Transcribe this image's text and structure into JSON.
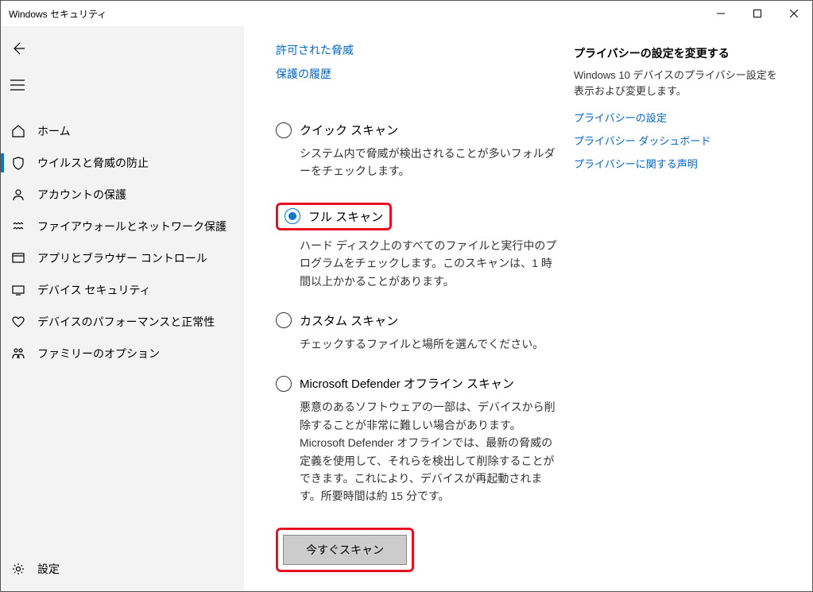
{
  "window": {
    "title": "Windows セキュリティ"
  },
  "sidebar": {
    "items": [
      {
        "label": "ホーム"
      },
      {
        "label": "ウイルスと脅威の防止"
      },
      {
        "label": "アカウントの保護"
      },
      {
        "label": "ファイアウォールとネットワーク保護"
      },
      {
        "label": "アプリとブラウザー コントロール"
      },
      {
        "label": "デバイス セキュリティ"
      },
      {
        "label": "デバイスのパフォーマンスと正常性"
      },
      {
        "label": "ファミリーのオプション"
      }
    ],
    "settings": "設定"
  },
  "main": {
    "toplinks": {
      "allowed": "許可された脅威",
      "history": "保護の履歴"
    },
    "options": {
      "quick": {
        "label": "クイック スキャン",
        "desc": "システム内で脅威が検出されることが多いフォルダーをチェックします。"
      },
      "full": {
        "label": "フル スキャン",
        "desc": "ハード ディスク上のすべてのファイルと実行中のプログラムをチェックします。このスキャンは、1 時間以上かかることがあります。"
      },
      "custom": {
        "label": "カスタム スキャン",
        "desc": "チェックするファイルと場所を選んでください。"
      },
      "offline": {
        "label": "Microsoft Defender オフライン スキャン",
        "desc": "悪意のあるソフトウェアの一部は、デバイスから削除することが非常に難しい場合があります。Microsoft Defender オフラインでは、最新の脅威の定義を使用して、それらを検出して削除することができます。これにより、デバイスが再起動されます。所要時間は約 15 分です。"
      }
    },
    "scan_button": "今すぐスキャン"
  },
  "right": {
    "heading": "プライバシーの設定を変更する",
    "desc": "Windows 10 デバイスのプライバシー設定を表示および変更します。",
    "links": {
      "settings": "プライバシーの設定",
      "dashboard": "プライバシー ダッシュボード",
      "statement": "プライバシーに関する声明"
    }
  }
}
